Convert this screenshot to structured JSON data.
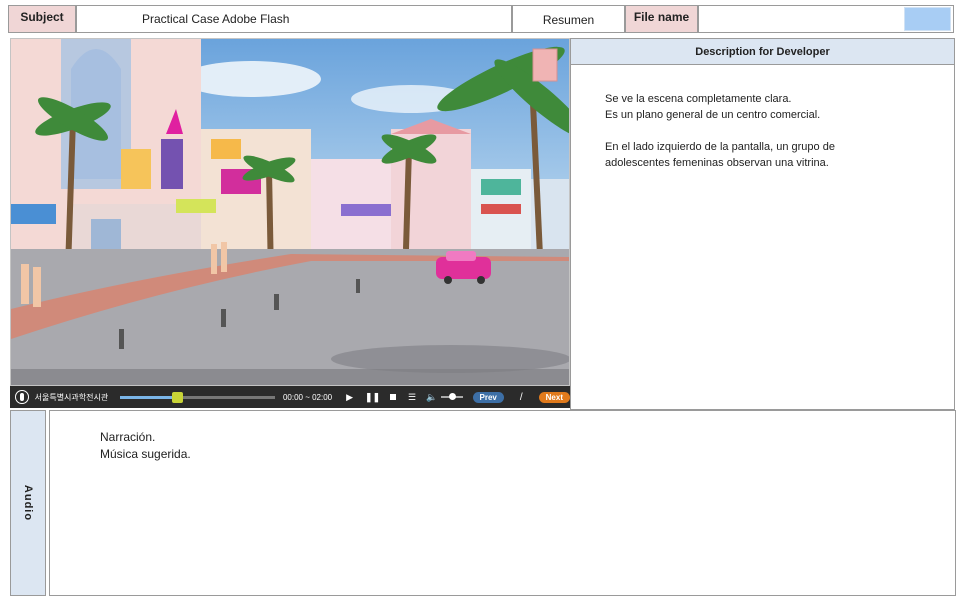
{
  "header": {
    "subject_label": "Subject",
    "subject_value": "Practical Case Adobe Flash",
    "resumen_button": "Resumen",
    "filename_label": "File name",
    "filename_value": ""
  },
  "player": {
    "logo_text": "서울특별시과학전시관",
    "time": "00:00 ~ 02:00",
    "prev_label": "Prev",
    "separator": "/",
    "next_label": "Next",
    "progress": 0.37,
    "volume": 0.5
  },
  "description": {
    "title": "Description for Developer",
    "lines": [
      "Se ve la escena completamente clara.",
      "Es un plano general de un centro comercial.",
      "En el lado izquierdo de la pantalla, un grupo de",
      "adolescentes femeninas observan una vitrina."
    ]
  },
  "audio": {
    "label": "Audio",
    "lines": [
      "Narración.",
      "Música sugerida."
    ]
  },
  "colors": {
    "label_pink": "#f0d6d6",
    "label_blue": "#dce6f2",
    "swatch": "#a8cdf4",
    "prev_button": "#3d6fa6",
    "next_button": "#e07a1c"
  }
}
